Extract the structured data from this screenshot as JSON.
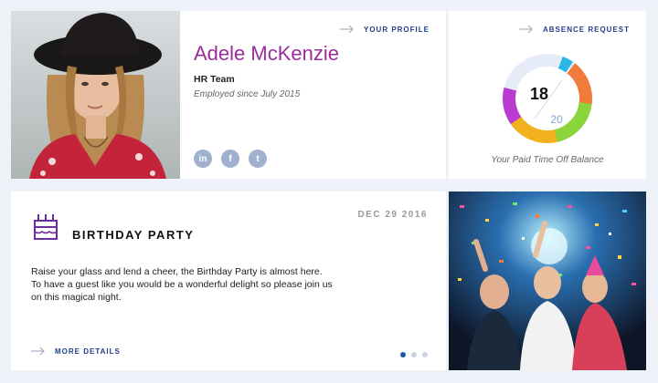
{
  "profile": {
    "name": "Adele McKenzie",
    "team": "HR Team",
    "employed_since": "Employed since July 2015",
    "link_label": "YOUR PROFILE",
    "photo_icon": "portrait-photo",
    "socials": [
      {
        "icon": "linkedin-icon",
        "glyph": "in"
      },
      {
        "icon": "facebook-icon",
        "glyph": "f"
      },
      {
        "icon": "twitter-icon",
        "glyph": "t"
      }
    ]
  },
  "absence": {
    "link_label": "ABSENCE REQUEST",
    "value_used": "18",
    "value_total": "20",
    "balance_label": "Your  Paid Time Off Balance",
    "ring_colors": [
      "#e6ecf7",
      "#29b7e8",
      "#f07b3a",
      "#8bd43a",
      "#f2b21e",
      "#b93bd1"
    ]
  },
  "event": {
    "date": "DEC 29 2016",
    "title": "BIRTHDAY PARTY",
    "body_lines": [
      "Raise your glass and lend a cheer, the Birthday Party is almost here.",
      "To have a guest like you would be a wonderful delight so please join us",
      "on this magical night."
    ],
    "link_label": "MORE DETAILS",
    "dots": [
      "active",
      "inactive",
      "inactive"
    ]
  },
  "colors": {
    "accent_blue": "#1f3f8a",
    "name_purple": "#9b2c9b",
    "page_bg": "#eef1f7"
  }
}
